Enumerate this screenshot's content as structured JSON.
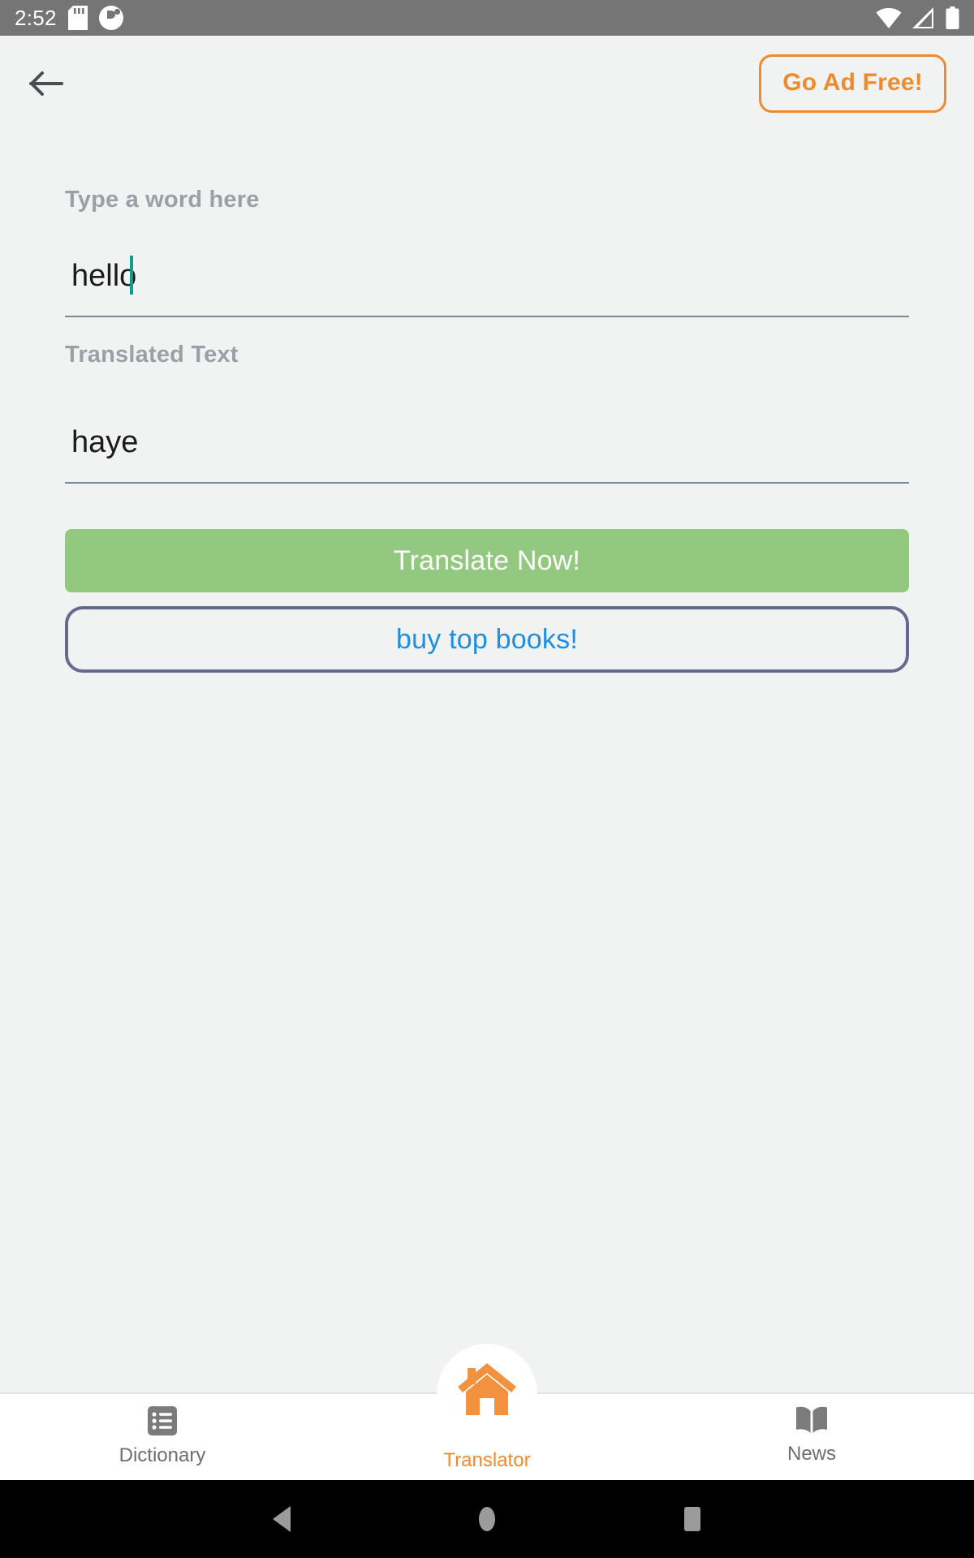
{
  "status_bar": {
    "time": "2:52",
    "left_icons": [
      "sd-card-icon",
      "app-notification-icon"
    ],
    "right_icons": [
      "wifi-icon",
      "cellular-signal-icon",
      "battery-icon"
    ],
    "background_color": "#757575"
  },
  "app_bar": {
    "back_icon": "back-arrow-icon",
    "go_ad_free_label": "Go Ad Free!",
    "accent_color": "#ef8b2c"
  },
  "form": {
    "source": {
      "label": "Type a word here",
      "value": "hello",
      "placeholder": "Type a word here",
      "caret_color": "#0f9b8e"
    },
    "target": {
      "label": "Translated Text",
      "value": "haye",
      "placeholder": "Translated Text"
    }
  },
  "actions": {
    "translate_label": "Translate Now!",
    "translate_color": "#92c87f",
    "books_label": "buy top books!",
    "books_text_color": "#1f8fe0",
    "books_border_color": "#646b8c"
  },
  "bottom_nav": {
    "items": [
      {
        "label": "Dictionary",
        "icon": "list-icon",
        "active": false
      },
      {
        "label": "Translator",
        "icon": "home-icon",
        "active": true
      },
      {
        "label": "News",
        "icon": "open-book-icon",
        "active": false
      }
    ],
    "active_color": "#ef8b2c",
    "inactive_color": "#6e6e6e"
  },
  "system_nav": {
    "back_icon": "system-back-icon",
    "home_icon": "system-home-icon",
    "recents_icon": "system-recents-icon"
  }
}
